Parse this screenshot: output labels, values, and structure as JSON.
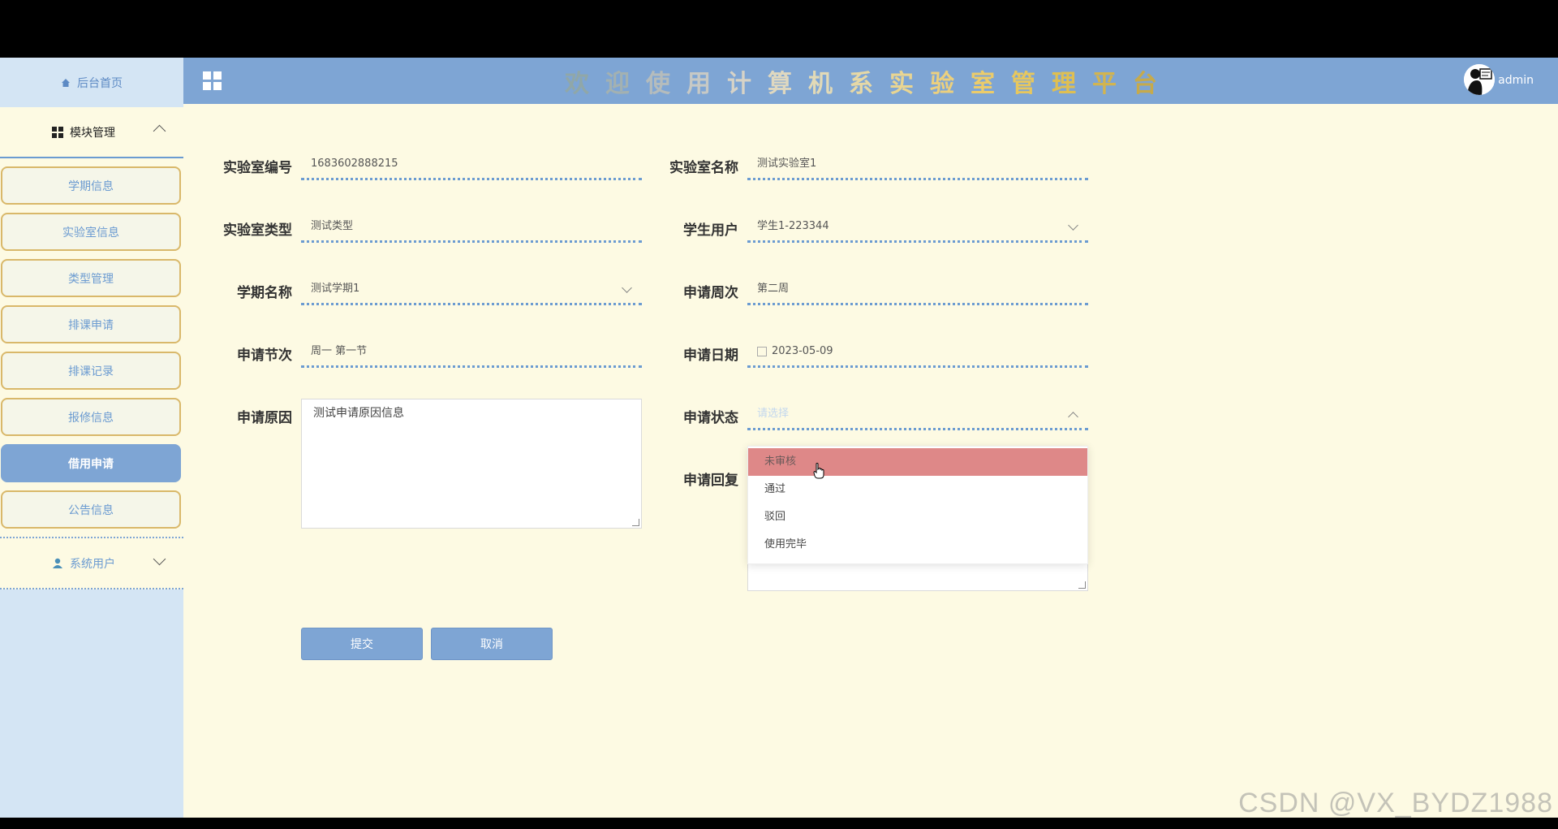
{
  "header": {
    "title_chars": [
      "欢",
      "迎",
      "使",
      "用",
      "计",
      "算",
      "机",
      "系",
      "实",
      "验",
      "室",
      "管",
      "理",
      "平",
      "台"
    ],
    "title_colors": [
      "#90a7a8",
      "#a3b1b1",
      "#b5bcbc",
      "#c7c9c5",
      "#d7d3c7",
      "#dfd8c0",
      "#e2dab7",
      "#e6d8a6",
      "#e9d592",
      "#ecd07e",
      "#eccc6a",
      "#e7c75e",
      "#dfbf52",
      "#d2b450",
      "#c6aa4c"
    ],
    "username": "admin",
    "colors": {
      "bar": "#7ea5d4"
    }
  },
  "sidebar": {
    "home": "后台首页",
    "module_label": "模块管理",
    "items": [
      {
        "label": "学期信息"
      },
      {
        "label": "实验室信息"
      },
      {
        "label": "类型管理"
      },
      {
        "label": "排课申请"
      },
      {
        "label": "排课记录"
      },
      {
        "label": "报修信息"
      },
      {
        "label": "借用申请",
        "active": true
      },
      {
        "label": "公告信息"
      }
    ],
    "system_users": "系统用户"
  },
  "form": {
    "lab_no": {
      "label": "实验室编号",
      "value": "1683602888215"
    },
    "lab_name": {
      "label": "实验室名称",
      "value": "测试实验室1"
    },
    "lab_type": {
      "label": "实验室类型",
      "value": "测试类型"
    },
    "student": {
      "label": "学生用户",
      "value": "学生1-223344"
    },
    "term": {
      "label": "学期名称",
      "value": "测试学期1"
    },
    "week": {
      "label": "申请周次",
      "value": "第二周"
    },
    "session": {
      "label": "申请节次",
      "value": "周一 第一节"
    },
    "date": {
      "label": "申请日期",
      "value": "2023-05-09"
    },
    "reason": {
      "label": "申请原因",
      "value": "测试申请原因信息"
    },
    "status": {
      "label": "申请状态",
      "placeholder": "请选择",
      "options": [
        "未审核",
        "通过",
        "驳回",
        "使用完毕"
      ],
      "hovered": "未审核"
    },
    "reply": {
      "label": "申请回复"
    },
    "submit": "提交",
    "cancel": "取消"
  },
  "watermark": "CSDN @VX_BYDZ1988"
}
